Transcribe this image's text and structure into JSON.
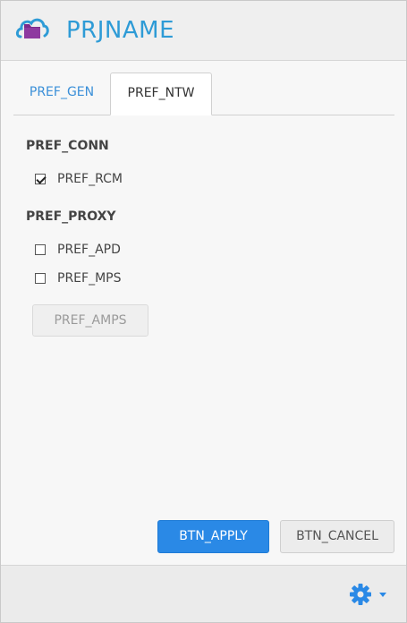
{
  "app": {
    "title": "PRJNAME",
    "logo_icon": "folder-cloud-icon"
  },
  "tabs": [
    {
      "label": "PREF_GEN",
      "active": false
    },
    {
      "label": "PREF_NTW",
      "active": true
    }
  ],
  "connection": {
    "heading": "PREF_CONN",
    "options": [
      {
        "label": "PREF_RCM",
        "checked": true
      }
    ]
  },
  "proxy": {
    "heading": "PREF_PROXY",
    "options": [
      {
        "label": "PREF_APD",
        "checked": false
      },
      {
        "label": "PREF_MPS",
        "checked": false
      }
    ],
    "amps_button": "PREF_AMPS"
  },
  "actions": {
    "apply": "BTN_APPLY",
    "cancel": "BTN_CANCEL"
  },
  "footer": {
    "settings_icon": "gear-icon",
    "dropdown_icon": "caret-down-icon"
  },
  "colors": {
    "accent": "#2e9bd6",
    "primary_button": "#2a89e6",
    "logo_purple": "#7b2a8c"
  }
}
